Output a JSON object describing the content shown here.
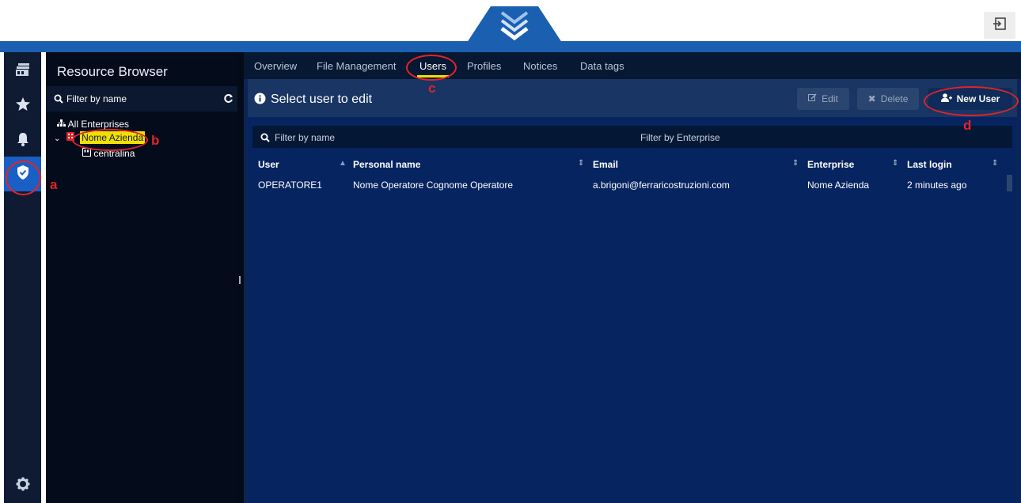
{
  "header": {
    "logout_icon": "logout-icon"
  },
  "rail": {
    "items": [
      {
        "name": "dashboard-icon"
      },
      {
        "name": "star-icon"
      },
      {
        "name": "bell-icon"
      },
      {
        "name": "shield-icon",
        "active": true
      },
      {
        "name": "gear-icon"
      }
    ]
  },
  "resource_browser": {
    "title": "Resource Browser",
    "filter_placeholder": "Filter by name",
    "tree": {
      "root": "All Enterprises",
      "company": "Nome Azienda",
      "child": "centralina"
    }
  },
  "tabs": [
    "Overview",
    "File Management",
    "Users",
    "Profiles",
    "Notices",
    "Data tags"
  ],
  "active_tab": "Users",
  "panel": {
    "title": "Select user to edit",
    "edit_label": "Edit",
    "delete_label": "Delete",
    "new_user_label": "New User"
  },
  "filters": {
    "name": "Filter by name",
    "enterprise": "Filter by Enterprise"
  },
  "table": {
    "columns": [
      "User",
      "Personal name",
      "Email",
      "Enterprise",
      "Last login"
    ],
    "rows": [
      {
        "user": "OPERATORE1",
        "personal_name": "Nome Operatore Cognome Operatore",
        "email": "a.brigoni@ferraricostruzioni.com",
        "enterprise": "Nome Azienda",
        "last_login": "2 minutes ago"
      }
    ]
  },
  "annotations": {
    "a": "a",
    "b": "b",
    "c": "c",
    "d": "d",
    "color": "#e1232a"
  },
  "colors": {
    "accent_blue": "#1b5fb0",
    "highlight_yellow": "#f2e100",
    "panel_bg": "#062560"
  }
}
